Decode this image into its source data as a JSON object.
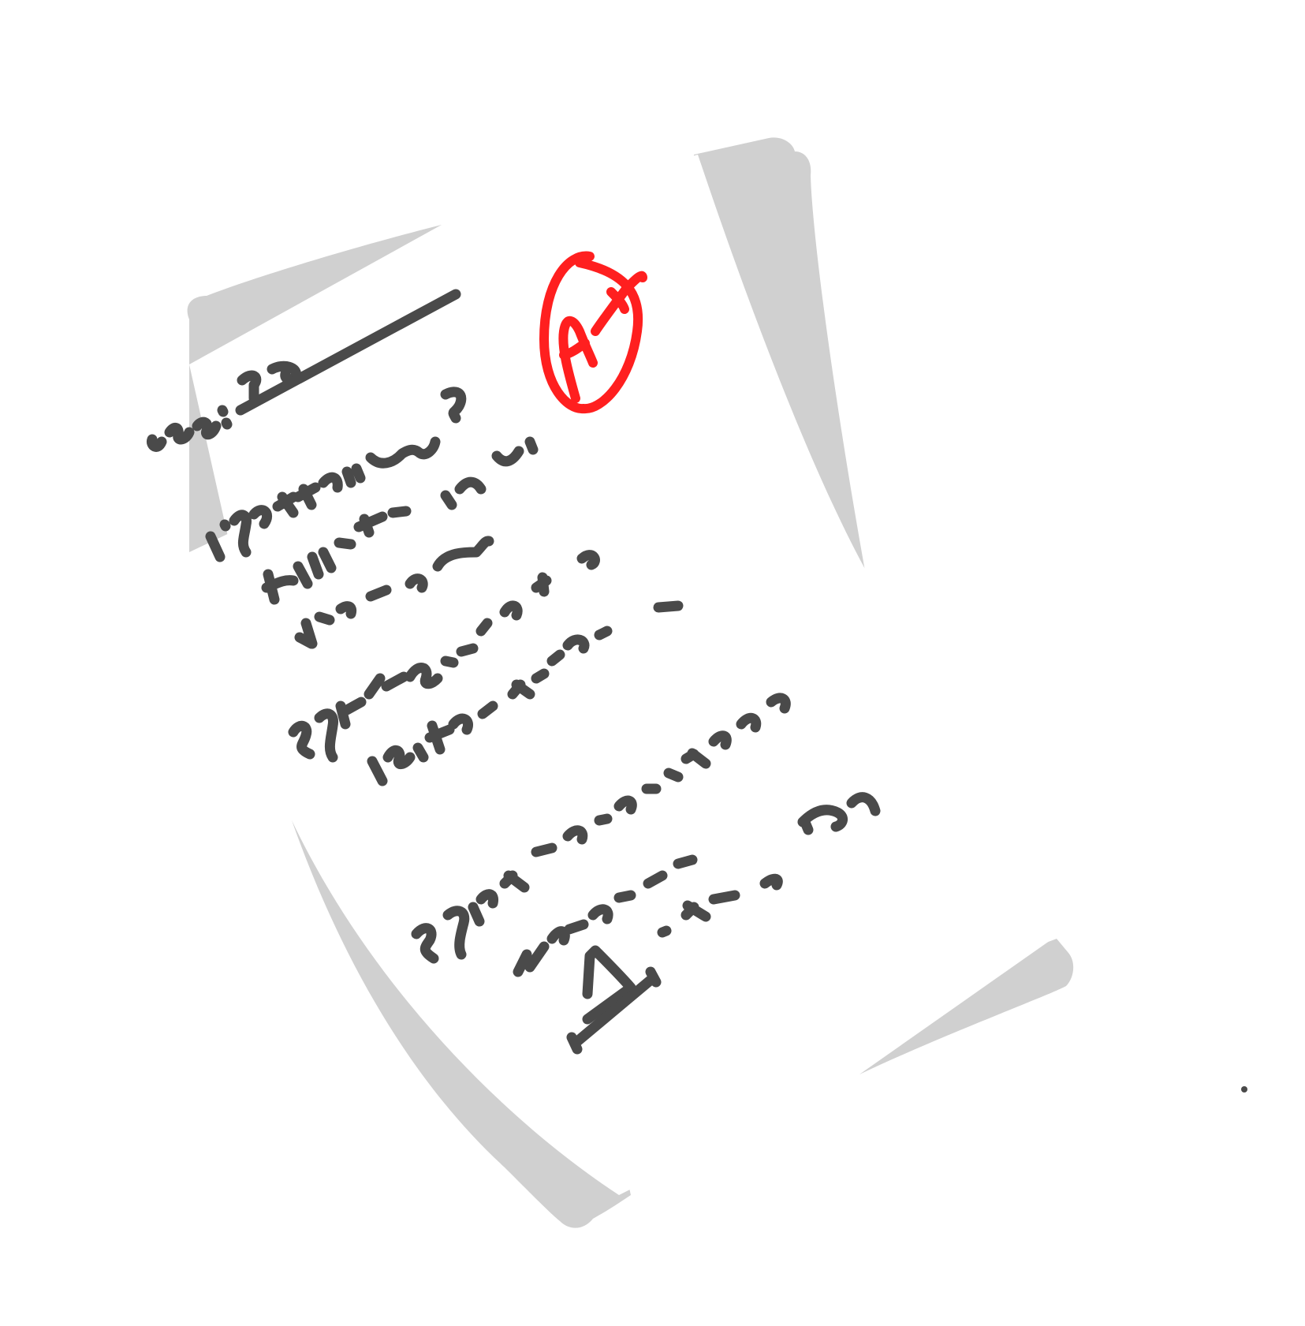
{
  "illustration": {
    "subject": "graded-test-paper",
    "grade_mark": "A+",
    "colors": {
      "paper": "#ffffff",
      "paper_shadow": "#d0d0d0",
      "ink": "#4a4a4a",
      "grade_ink": "#ff1f1f"
    },
    "questions": [
      "1)",
      "2)",
      "3)"
    ]
  }
}
